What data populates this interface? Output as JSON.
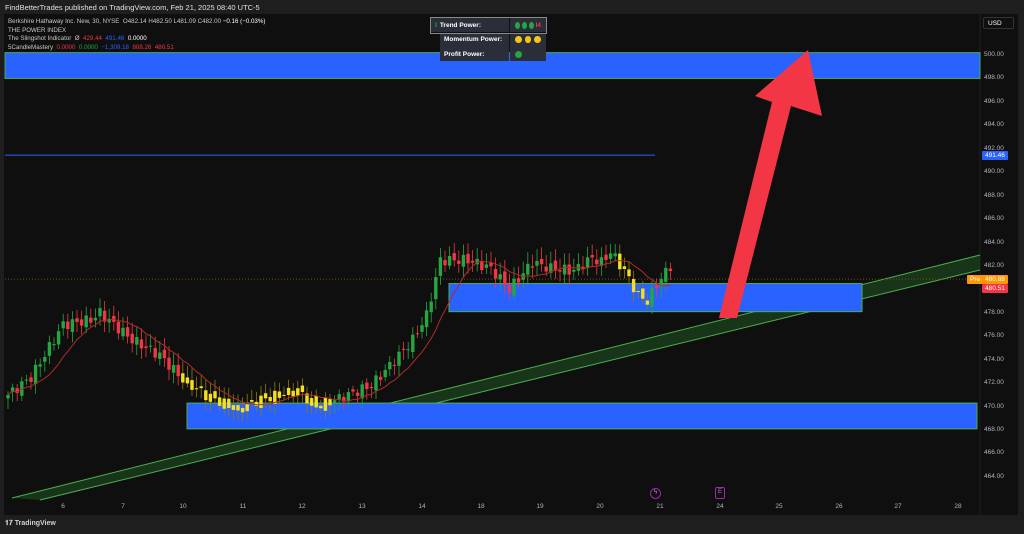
{
  "header": {
    "publisher_line": "FindBetterTrades published on TradingView.com, Feb 21, 2025 08:40 UTC-5"
  },
  "legend": {
    "symbol": "Berkshire Hathaway Inc. New, 30, NYSE",
    "open": "O482.14",
    "high": "H482.50",
    "low": "L481.09",
    "close": "C482.00",
    "change": "−0.16 (−0.03%)",
    "indicator1": "THE POWER INDEX",
    "indicator2": {
      "name": "The Slingshot Indicator",
      "symbol": "Ø",
      "v1": "429.44",
      "v2": "491.46",
      "v3": "0.0000"
    },
    "indicator3": {
      "name": "5CandleMastery",
      "v1": "0.0000",
      "v2": "0.0000",
      "v3": "−1,309.18",
      "v4": "808.26",
      "v5": "480.51"
    }
  },
  "power_table": {
    "rows": [
      {
        "label": "Trend Power:",
        "dots": [
          "#26a641",
          "#26a641",
          "#26a641"
        ],
        "prefix": "I",
        "suffix": "I4"
      },
      {
        "label": "Momentum Power:",
        "dots": [
          "#f5c518",
          "#f5c518",
          "#f5c518"
        ]
      },
      {
        "label": "Profit Power:",
        "dots": [
          "#26a641"
        ]
      }
    ]
  },
  "price_axis": {
    "currency": "USD",
    "labels": [
      "500.00",
      "498.00",
      "496.00",
      "494.00",
      "492.00",
      "490.00",
      "488.00",
      "486.00",
      "484.00",
      "482.00",
      "480.00",
      "478.00",
      "476.00",
      "474.00",
      "472.00",
      "470.00",
      "468.00",
      "466.00",
      "464.00"
    ],
    "tags": {
      "slingshot": "491.46",
      "pre_label": "Pre",
      "pre": "480.88",
      "last": "480.51"
    }
  },
  "time_axis": {
    "labels": [
      "6",
      "7",
      "10",
      "11",
      "12",
      "13",
      "14",
      "18",
      "19",
      "20",
      "21",
      "24",
      "25",
      "26",
      "27",
      "28"
    ]
  },
  "footer": {
    "brand": "TradingView"
  },
  "colors": {
    "up": "#26a641",
    "down": "#f23645",
    "yellow": "#f5e020",
    "zone": "#2962ff",
    "zone_border": "#4caf50",
    "arrow": "#f23645"
  },
  "chart_data": {
    "type": "candlestick",
    "ylim": [
      463,
      501
    ],
    "close_keypoints": [
      [
        0,
        471
      ],
      [
        5,
        472.5
      ],
      [
        12,
        477
      ],
      [
        18,
        477.4
      ],
      [
        20,
        478
      ],
      [
        27,
        475.7
      ],
      [
        33,
        474.4
      ],
      [
        38,
        472.3
      ],
      [
        43,
        471
      ],
      [
        50,
        469.7
      ],
      [
        54,
        470.5
      ],
      [
        59,
        471
      ],
      [
        63,
        471.4
      ],
      [
        67,
        470
      ],
      [
        74,
        471
      ],
      [
        79,
        471.8
      ],
      [
        83,
        473.5
      ],
      [
        88,
        475.7
      ],
      [
        91,
        477.8
      ],
      [
        94,
        482.5
      ],
      [
        100,
        482.5
      ],
      [
        105,
        481.8
      ],
      [
        109,
        480
      ],
      [
        114,
        482.3
      ],
      [
        118,
        481.8
      ],
      [
        123,
        481.6
      ],
      [
        127,
        482.7
      ],
      [
        129,
        482.3
      ],
      [
        131,
        483.2
      ],
      [
        134,
        481.6
      ],
      [
        137,
        479.5
      ],
      [
        139,
        479
      ],
      [
        141,
        480.4
      ],
      [
        144,
        482
      ]
    ],
    "zones": [
      [
        498,
        500.2
      ],
      [
        478.1,
        480.5
      ],
      [
        468.1,
        470.3
      ]
    ],
    "slingshot_line": 491.46,
    "pre_price": 480.88
  }
}
